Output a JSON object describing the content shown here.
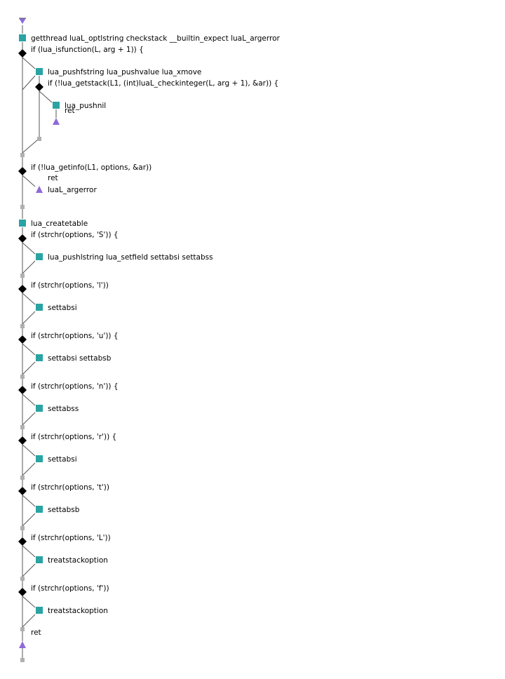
{
  "nodes": {
    "n1": "getthread  luaL_optlstring  checkstack  __builtin_expect  luaL_argerror",
    "c1": "if (lua_isfunction(L, arg + 1)) {",
    "n2": "lua_pushfstring  lua_pushvalue  lua_xmove",
    "c2": "if (!lua_getstack(L1, (int)luaL_checkinteger(L, arg + 1), &ar)) {",
    "n3": "lua_pushnil",
    "r1": "ret",
    "c3": "if (!lua_getinfo(L1, options, &ar))",
    "r2": "ret",
    "n4": "luaL_argerror",
    "n5": "lua_createtable",
    "c4": "if (strchr(options, 'S')) {",
    "n6": "lua_pushlstring  lua_setfield  settabsi  settabss",
    "c5": "if (strchr(options, 'l'))",
    "n7": "settabsi",
    "c6": "if (strchr(options, 'u')) {",
    "n8": "settabsi  settabsb",
    "c7": "if (strchr(options, 'n')) {",
    "n9": "settabss",
    "c8": "if (strchr(options, 'r')) {",
    "n10": "settabsi",
    "c9": "if (strchr(options, 't'))",
    "n11": "settabsb",
    "c10": "if (strchr(options, 'L'))",
    "n12": "treatstackoption",
    "c11": "if (strchr(options, 'f'))",
    "n13": "treatstackoption",
    "r3": "ret"
  },
  "colors": {
    "statement": "#2aa3a3",
    "condition": "#000000",
    "join": "#b0b0b0",
    "terminal": "#8e6ad8",
    "edge": "#555555"
  }
}
